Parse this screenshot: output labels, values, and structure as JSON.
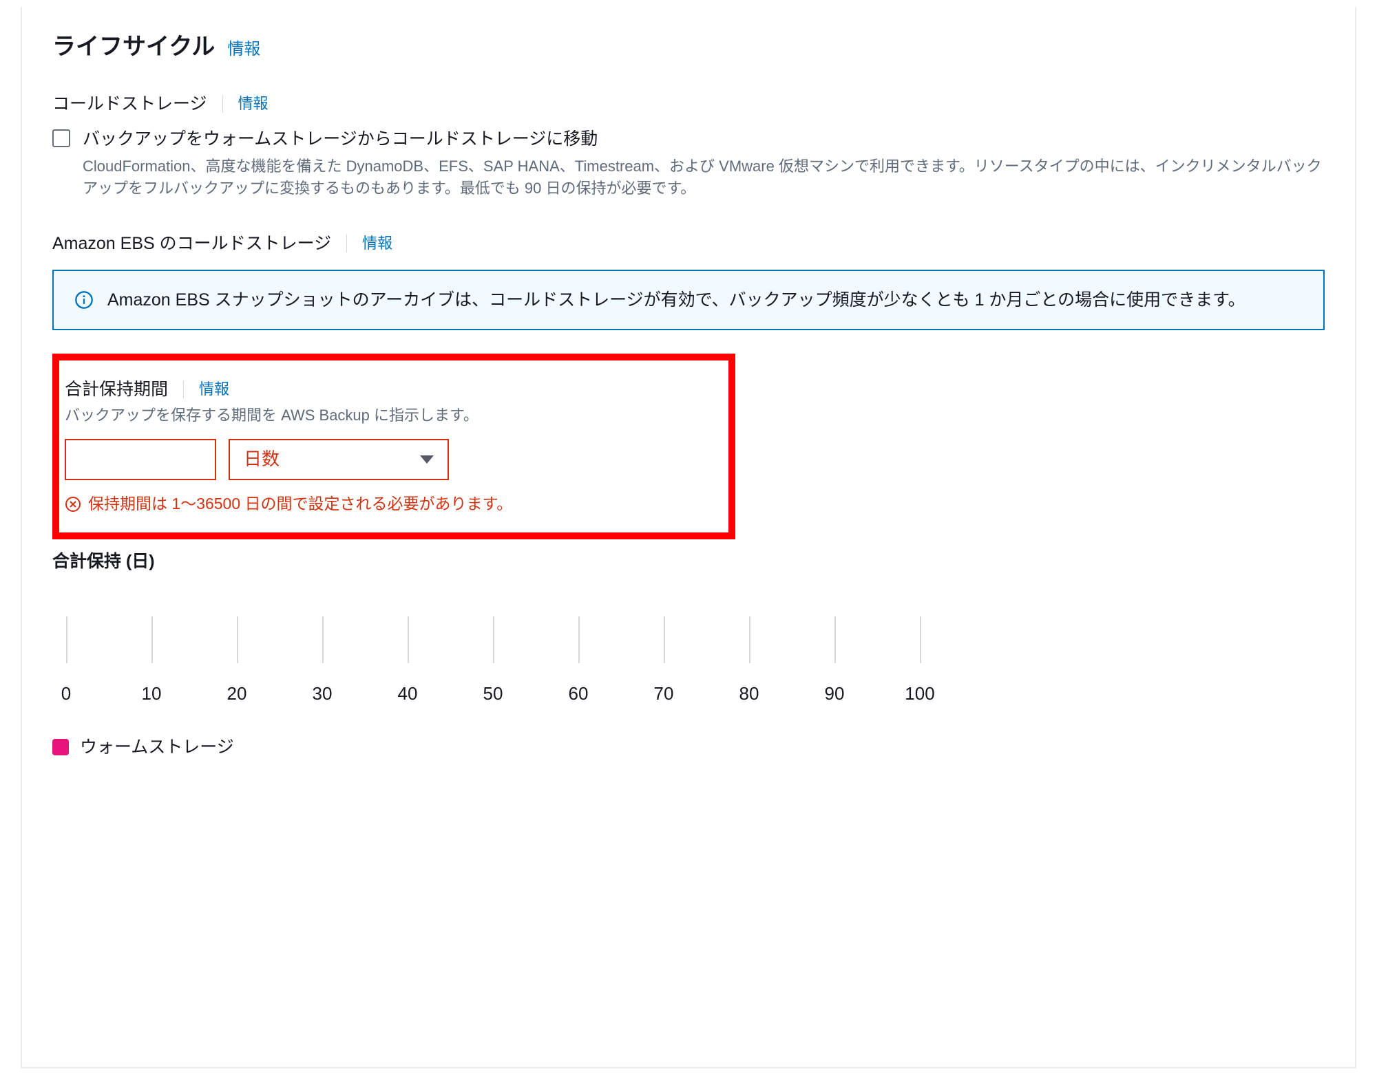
{
  "section": {
    "title": "ライフサイクル",
    "info": "情報"
  },
  "cold": {
    "label": "コールドストレージ",
    "info": "情報",
    "checkbox_label": "バックアップをウォームストレージからコールドストレージに移動",
    "checkbox_desc": "CloudFormation、高度な機能を備えた DynamoDB、EFS、SAP HANA、Timestream、および VMware 仮想マシンで利用できます。リソースタイプの中には、インクリメンタルバックアップをフルバックアップに変換するものもあります。最低でも 90 日の保持が必要です。"
  },
  "ebs": {
    "label": "Amazon EBS のコールドストレージ",
    "info": "情報",
    "banner": "Amazon EBS スナップショットのアーカイブは、コールドストレージが有効で、バックアップ頻度が少なくとも 1 か月ごとの場合に使用できます。"
  },
  "retention": {
    "title": "合計保持期間",
    "info": "情報",
    "desc": "バックアップを保存する期間を AWS Backup に指示します。",
    "value": "",
    "unit": "日数",
    "error": "保持期間は 1〜36500 日の間で設定される必要があります。"
  },
  "retain_days_title": "合計保持 (日)",
  "axis_ticks": [
    "0",
    "10",
    "20",
    "30",
    "40",
    "50",
    "60",
    "70",
    "80",
    "90",
    "100"
  ],
  "legend": {
    "label": "ウォームストレージ",
    "color": "#e7157b"
  },
  "chart_data": {
    "type": "bar",
    "title": "合計保持 (日)",
    "xlabel": "",
    "ylabel": "",
    "categories": [],
    "values": [],
    "xlim": [
      0,
      100
    ],
    "x_ticks": [
      0,
      10,
      20,
      30,
      40,
      50,
      60,
      70,
      80,
      90,
      100
    ],
    "series": [
      {
        "name": "ウォームストレージ",
        "color": "#e7157b",
        "values": []
      }
    ]
  }
}
